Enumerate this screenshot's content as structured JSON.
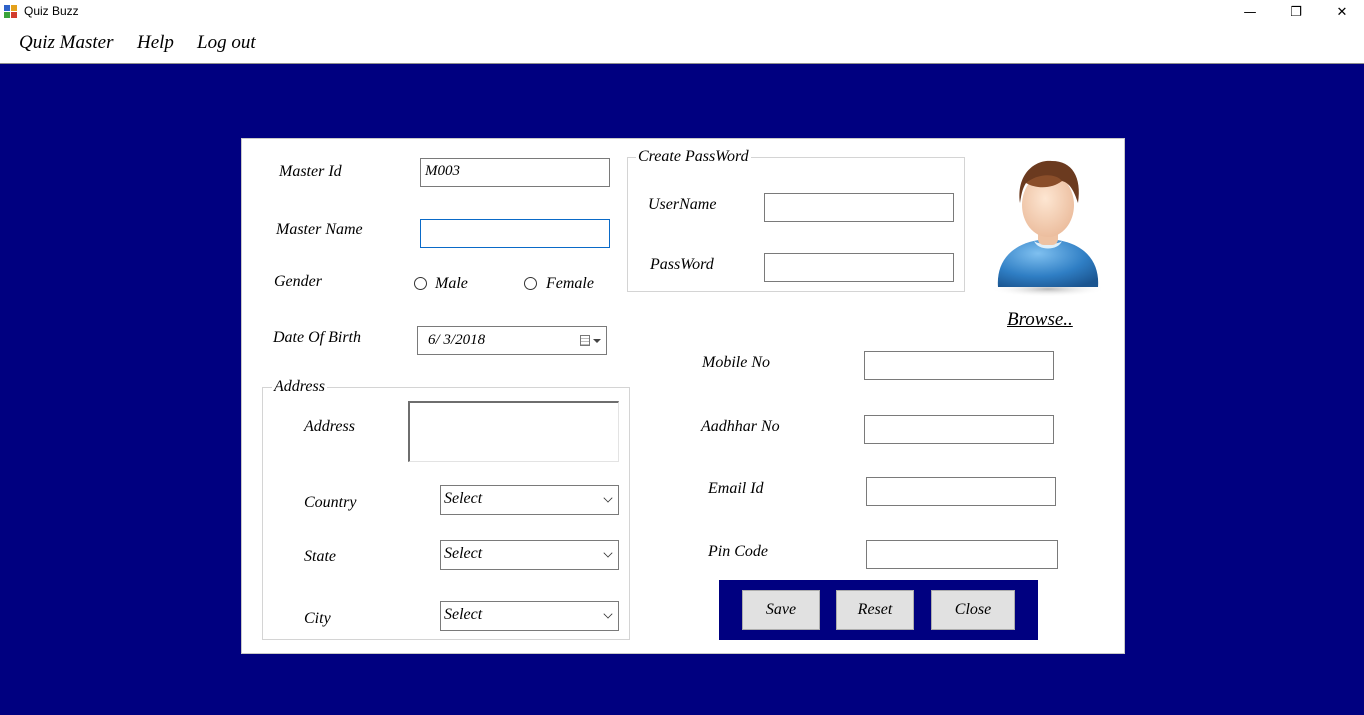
{
  "window": {
    "title": "Quiz Buzz",
    "minimize": "—",
    "restore": "❐",
    "close": "✕"
  },
  "menu": {
    "items": [
      "Quiz Master",
      "Help",
      "Log out"
    ]
  },
  "form": {
    "master_id": {
      "label": "Master Id",
      "value": "M003"
    },
    "master_name": {
      "label": "Master Name",
      "value": ""
    },
    "gender": {
      "label": "Gender",
      "options": [
        "Male",
        "Female"
      ]
    },
    "dob": {
      "label": "Date Of Birth",
      "value": "6/  3/2018"
    },
    "address_group": {
      "legend": "Address",
      "address": {
        "label": "Address",
        "value": ""
      },
      "country": {
        "label": "Country",
        "value": "Select"
      },
      "state": {
        "label": "State",
        "value": "Select"
      },
      "city": {
        "label": "City",
        "value": "Select"
      }
    },
    "password_group": {
      "legend": "Create PassWord",
      "username": {
        "label": "UserName",
        "value": ""
      },
      "password": {
        "label": "PassWord",
        "value": ""
      }
    },
    "browse": "Browse..",
    "mobile": {
      "label": "Mobile No",
      "value": ""
    },
    "aadhaar": {
      "label": "Aadhhar No",
      "value": ""
    },
    "email": {
      "label": "Email Id",
      "value": ""
    },
    "pincode": {
      "label": "Pin Code",
      "value": ""
    },
    "buttons": {
      "save": "Save",
      "reset": "Reset",
      "close": "Close"
    }
  },
  "colors": {
    "client_background": "#000080",
    "panel_background": "#ffffff",
    "button_face": "#e1e1e1",
    "focus_border": "#0a6ac8"
  }
}
